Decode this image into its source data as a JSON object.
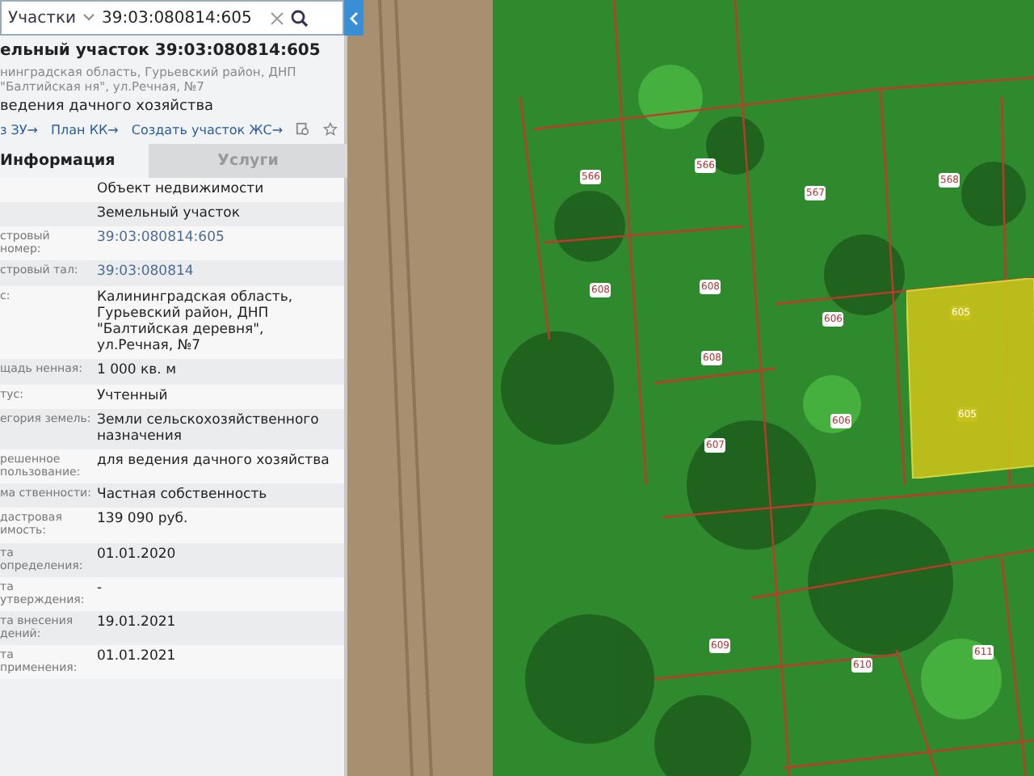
{
  "search": {
    "category": "Участки",
    "value": "39:03:080814:605"
  },
  "object": {
    "title": "ельный участок 39:03:080814:605",
    "address": "нинградская область, Гурьевский район, ДНП \"Балтийская ня\", ул.Речная, №7",
    "purpose": "ведения дачного хозяйства"
  },
  "links": [
    "з ЗУ→",
    "План КК→",
    "Создать участок ЖС→"
  ],
  "tabs": [
    {
      "label": "Информация",
      "selected": true
    },
    {
      "label": "Услуги",
      "selected": false
    }
  ],
  "rows": [
    {
      "label": "",
      "value": "Объект недвижимости",
      "kind": "plain"
    },
    {
      "label": "",
      "value": "Земельный участок",
      "kind": "plain"
    },
    {
      "label": "стровый номер:",
      "value": "39:03:080814:605",
      "kind": "link"
    },
    {
      "label": "стровый тал:",
      "value": "39:03:080814",
      "kind": "link"
    },
    {
      "label": "с:",
      "value": "Калининградская область, Гурьевский район, ДНП \"Балтийская деревня\", ул.Речная, №7",
      "kind": "plain"
    },
    {
      "label": "щадь ненная:",
      "value": "1 000 кв. м",
      "kind": "plain"
    },
    {
      "label": "тус:",
      "value": "Учтенный",
      "kind": "plain"
    },
    {
      "label": "егория земель:",
      "value": "Земли сельскохозяйственного назначения",
      "kind": "plain"
    },
    {
      "label": "решенное пользование:",
      "value": "для ведения дачного хозяйства",
      "kind": "plain"
    },
    {
      "label": "ма ственности:",
      "value": "Частная собственность",
      "kind": "plain"
    },
    {
      "label": "дастровая имость:",
      "value": "139 090 руб.",
      "kind": "plain"
    },
    {
      "label": "та определения:",
      "value": "01.01.2020",
      "kind": "plain"
    },
    {
      "label": "та утверждения:",
      "value": "-",
      "kind": "plain"
    },
    {
      "label": "та внесения дений:",
      "value": "19.01.2021",
      "kind": "plain"
    },
    {
      "label": "та применения:",
      "value": "01.01.2021",
      "kind": "plain"
    }
  ],
  "parcels": [
    {
      "number": "566",
      "selected": false
    },
    {
      "number": "566",
      "selected": false
    },
    {
      "number": "567",
      "selected": false
    },
    {
      "number": "568",
      "selected": false
    },
    {
      "number": "608",
      "selected": false
    },
    {
      "number": "608",
      "selected": false
    },
    {
      "number": "606",
      "selected": false
    },
    {
      "number": "605",
      "selected": true
    },
    {
      "number": "608",
      "selected": false
    },
    {
      "number": "606",
      "selected": false
    },
    {
      "number": "605",
      "selected": true
    },
    {
      "number": "607",
      "selected": false
    },
    {
      "number": "609",
      "selected": false
    },
    {
      "number": "610",
      "selected": false
    },
    {
      "number": "611",
      "selected": false
    }
  ]
}
